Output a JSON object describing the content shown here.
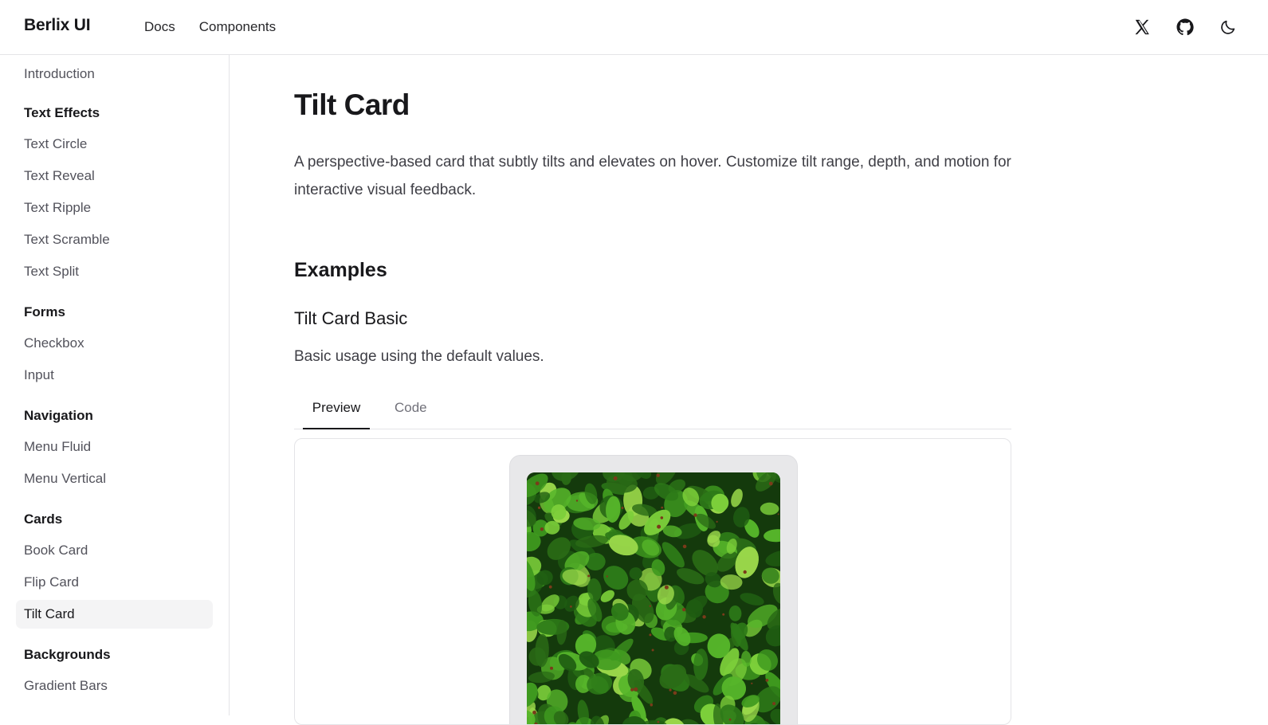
{
  "header": {
    "brand": "Berlix UI",
    "nav": [
      {
        "label": "Docs"
      },
      {
        "label": "Components"
      }
    ],
    "icons": [
      "x-logo-icon",
      "github-icon",
      "moon-icon"
    ]
  },
  "sidebar": {
    "intro": "Introduction",
    "groups": [
      {
        "heading": "Text Effects",
        "items": [
          "Text Circle",
          "Text Reveal",
          "Text Ripple",
          "Text Scramble",
          "Text Split"
        ]
      },
      {
        "heading": "Forms",
        "items": [
          "Checkbox",
          "Input"
        ]
      },
      {
        "heading": "Navigation",
        "items": [
          "Menu Fluid",
          "Menu Vertical"
        ]
      },
      {
        "heading": "Cards",
        "items": [
          "Book Card",
          "Flip Card",
          "Tilt Card"
        ]
      },
      {
        "heading": "Backgrounds",
        "items": [
          "Gradient Bars"
        ]
      }
    ],
    "active_item": "Tilt Card"
  },
  "main": {
    "title": "Tilt Card",
    "description": "A perspective-based card that subtly tilts and elevates on hover. Customize tilt range, depth, and motion for interactive visual feedback.",
    "section_title": "Examples",
    "example": {
      "title": "Tilt Card Basic",
      "description": "Basic usage using the default values.",
      "tabs": [
        {
          "label": "Preview",
          "active": true
        },
        {
          "label": "Code",
          "active": false
        }
      ],
      "preview_image": "green-leaves-photo"
    }
  },
  "colors": {
    "border": "#e4e4e7",
    "active_bg": "#f4f4f5",
    "text_primary": "#18181b",
    "text_muted": "#52525b",
    "card_bg": "#e8e8ea",
    "leaf_green": "#3f9a1f"
  }
}
